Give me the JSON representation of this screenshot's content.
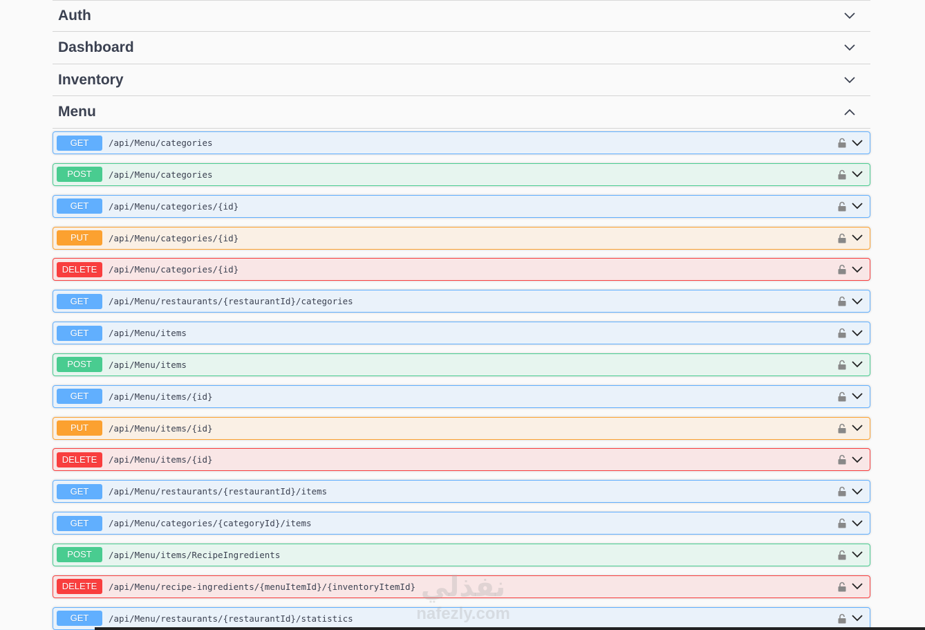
{
  "tags": [
    {
      "name": "Auth",
      "expanded": false
    },
    {
      "name": "Dashboard",
      "expanded": false
    },
    {
      "name": "Inventory",
      "expanded": false
    },
    {
      "name": "Menu",
      "expanded": true
    }
  ],
  "menu_operations": [
    {
      "method": "GET",
      "path": "/api/Menu/categories"
    },
    {
      "method": "POST",
      "path": "/api/Menu/categories"
    },
    {
      "method": "GET",
      "path": "/api/Menu/categories/{id}"
    },
    {
      "method": "PUT",
      "path": "/api/Menu/categories/{id}"
    },
    {
      "method": "DELETE",
      "path": "/api/Menu/categories/{id}"
    },
    {
      "method": "GET",
      "path": "/api/Menu/restaurants/{restaurantId}/categories"
    },
    {
      "method": "GET",
      "path": "/api/Menu/items"
    },
    {
      "method": "POST",
      "path": "/api/Menu/items"
    },
    {
      "method": "GET",
      "path": "/api/Menu/items/{id}"
    },
    {
      "method": "PUT",
      "path": "/api/Menu/items/{id}"
    },
    {
      "method": "DELETE",
      "path": "/api/Menu/items/{id}"
    },
    {
      "method": "GET",
      "path": "/api/Menu/restaurants/{restaurantId}/items"
    },
    {
      "method": "GET",
      "path": "/api/Menu/categories/{categoryId}/items"
    },
    {
      "method": "POST",
      "path": "/api/Menu/items/RecipeIngredients"
    },
    {
      "method": "DELETE",
      "path": "/api/Menu/recipe-ingredients/{menuItemId}/{inventoryItemId}"
    },
    {
      "method": "GET",
      "path": "/api/Menu/restaurants/{restaurantId}/statistics"
    }
  ],
  "icons": {
    "tag_collapsed": "chevron-down-icon",
    "tag_expanded": "chevron-up-icon",
    "operation_lock": "lock-icon",
    "operation_expand": "chevron-down-icon"
  },
  "colors": {
    "get": "#61affe",
    "post": "#49cc90",
    "put": "#fca130",
    "delete": "#f93e3e",
    "text": "#3b4151"
  },
  "watermark": {
    "arabic": "نفذلي",
    "latin": "nafezly.com"
  }
}
